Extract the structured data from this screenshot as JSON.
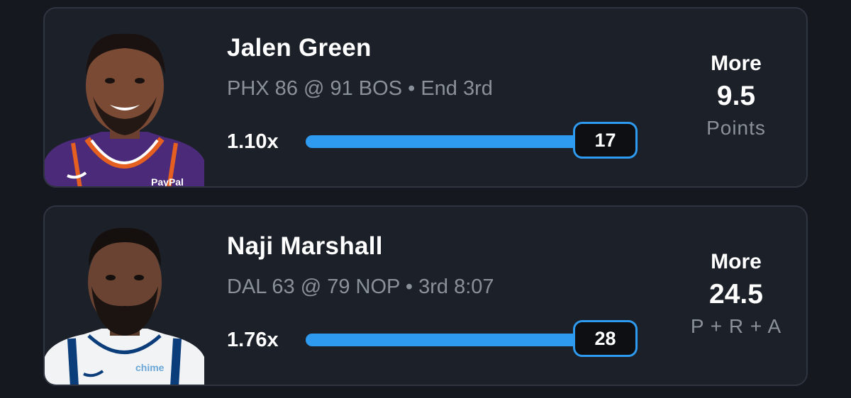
{
  "projections": [
    {
      "player": "Jalen Green",
      "game_status": "PHX 86 @ 91 BOS • End 3rd",
      "multiplier": "1.10x",
      "current_stat": "17",
      "progress": 1.0,
      "pick": "More",
      "line": "9.5",
      "stat_type": "Points",
      "jersey_color": "#4b2a7a",
      "jersey_trim": "#e56020"
    },
    {
      "player": "Naji Marshall",
      "game_status": "DAL 63 @ 79 NOP • 3rd 8:07",
      "multiplier": "1.76x",
      "current_stat": "28",
      "progress": 1.0,
      "pick": "More",
      "line": "24.5",
      "stat_type": "P + R + A",
      "jersey_color": "#f2f3f5",
      "jersey_trim": "#0b3d7a"
    }
  ],
  "colors": {
    "accent": "#2e9bf1",
    "card": "#1c2028",
    "background": "#15181e",
    "muted_text": "#8b919b"
  }
}
